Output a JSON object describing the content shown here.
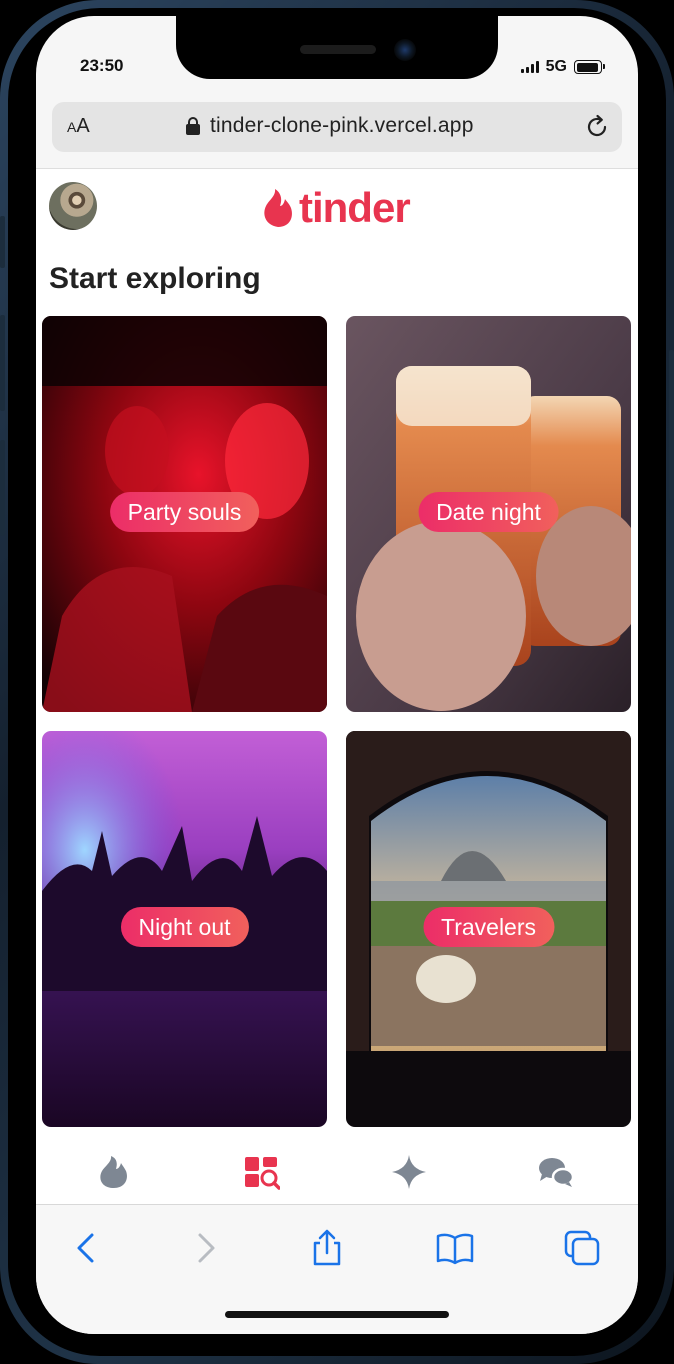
{
  "status": {
    "time": "23:50",
    "network": "5G"
  },
  "browser": {
    "text_size_label_small": "A",
    "text_size_label_large": "A",
    "url": "tinder-clone-pink.vercel.app"
  },
  "app": {
    "logo_text": "tinder",
    "brand_color": "#e8344f",
    "page_title": "Start exploring"
  },
  "categories": [
    {
      "label": "Party souls"
    },
    {
      "label": "Date night"
    },
    {
      "label": "Night out"
    },
    {
      "label": "Travelers"
    }
  ],
  "tabs": [
    {
      "icon": "flame-icon",
      "active": false
    },
    {
      "icon": "explore-icon",
      "active": true
    },
    {
      "icon": "sparkle-icon",
      "active": false
    },
    {
      "icon": "chat-icon",
      "active": false
    }
  ],
  "safari_toolbar": [
    "back-icon",
    "forward-icon",
    "share-icon",
    "bookmarks-icon",
    "tabs-icon"
  ]
}
